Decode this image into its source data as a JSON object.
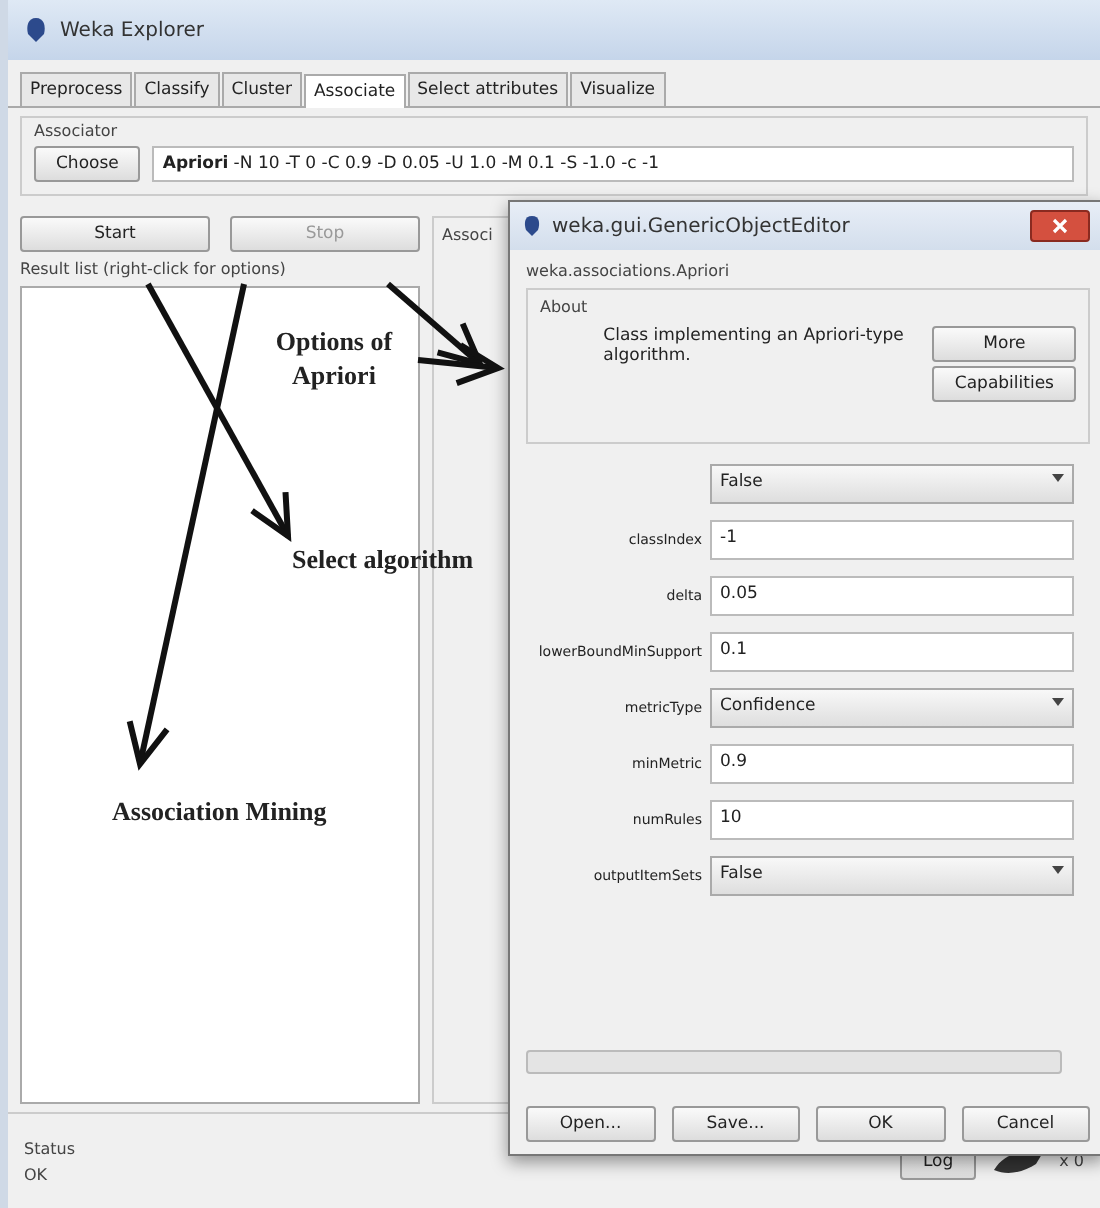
{
  "window": {
    "title": "Weka Explorer"
  },
  "tabs": [
    {
      "label": "Preprocess",
      "selected": false
    },
    {
      "label": "Classify",
      "selected": false
    },
    {
      "label": "Cluster",
      "selected": false
    },
    {
      "label": "Associate",
      "selected": true
    },
    {
      "label": "Select attributes",
      "selected": false
    },
    {
      "label": "Visualize",
      "selected": false
    }
  ],
  "associator": {
    "group_label": "Associator",
    "choose_button": "Choose",
    "scheme_name": "Apriori",
    "scheme_options": "-N 10 -T 0 -C 0.9 -D 0.05 -U 1.0 -M 0.1 -S -1.0 -c -1"
  },
  "controls": {
    "start_button": "Start",
    "stop_button": "Stop",
    "result_list_label": "Result list (right-click for options)",
    "output_label": "Associ"
  },
  "status": {
    "label": "Status",
    "text": "OK",
    "log_button": "Log",
    "count": "x 0"
  },
  "dialog": {
    "title": "weka.gui.GenericObjectEditor",
    "class_name": "weka.associations.Apriori",
    "about_label": "About",
    "about_text": "Class implementing an Apriori-type algorithm.",
    "more_button": "More",
    "capabilities_button": "Capabilities",
    "properties": [
      {
        "kind": "dropdown",
        "value": "False"
      },
      {
        "kind": "text",
        "label": "classIndex",
        "value": "-1"
      },
      {
        "kind": "text",
        "label": "delta",
        "value": "0.05"
      },
      {
        "kind": "text",
        "label": "lowerBoundMinSupport",
        "value": "0.1"
      },
      {
        "kind": "dropdown",
        "label": "metricType",
        "value": "Confidence"
      },
      {
        "kind": "text",
        "label": "minMetric",
        "value": "0.9"
      },
      {
        "kind": "text",
        "label": "numRules",
        "value": "10"
      },
      {
        "kind": "dropdown",
        "label": "outputItemSets",
        "value": "False"
      }
    ],
    "buttons": [
      "Open...",
      "Save...",
      "OK",
      "Cancel"
    ]
  },
  "annotations": [
    {
      "text": "Options of Apriori"
    },
    {
      "text": "Select algorithm"
    },
    {
      "text": "Association Mining"
    }
  ]
}
